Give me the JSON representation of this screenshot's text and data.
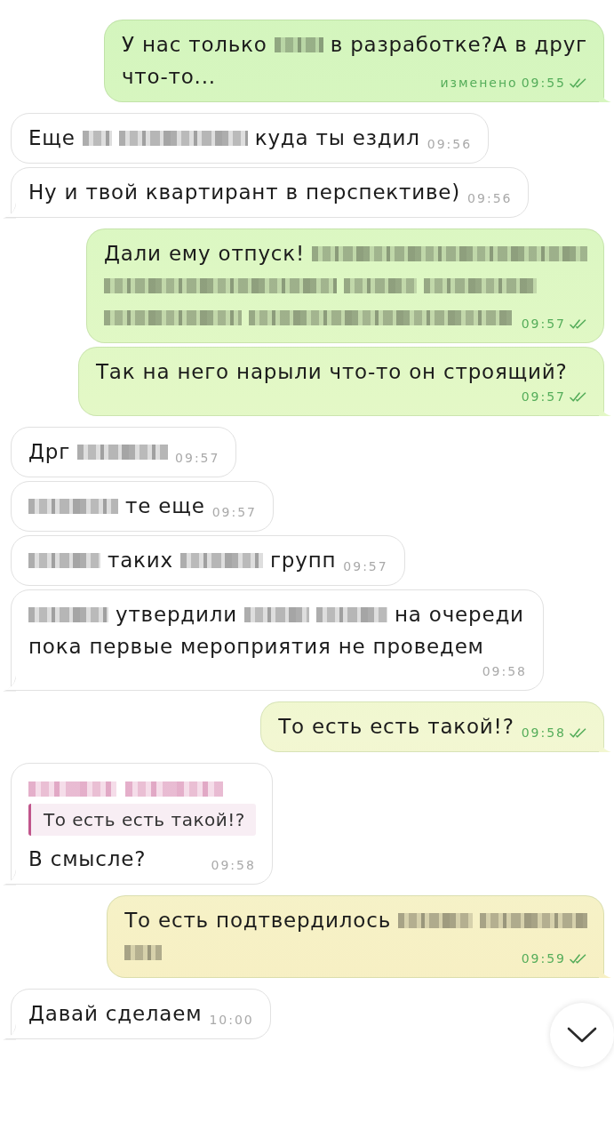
{
  "chat": {
    "messages": [
      {
        "kind": "outgoing",
        "lines": [
          [
            {
              "kind": "text",
              "text": "У нас только"
            },
            {
              "kind": "redacted"
            },
            {
              "kind": "text",
              "text": "в разработке?А в друг"
            }
          ],
          [
            {
              "kind": "text",
              "text": "что-то..."
            }
          ]
        ],
        "edited_label": "изменено",
        "time": "09:55",
        "read": true
      },
      {
        "kind": "incoming",
        "lines": [
          [
            {
              "kind": "text",
              "text": "Еще"
            },
            {
              "kind": "redacted"
            },
            {
              "kind": "redacted"
            },
            {
              "kind": "text",
              "text": "куда ты ездил"
            }
          ]
        ],
        "time": "09:56"
      },
      {
        "kind": "incoming",
        "lines": [
          [
            {
              "kind": "text",
              "text": "Ну и твой квартирант в перспективе)"
            }
          ]
        ],
        "time": "09:56"
      },
      {
        "kind": "outgoing",
        "lines": [
          [
            {
              "kind": "text",
              "text": "Дали ему отпуск!"
            },
            {
              "kind": "redacted"
            }
          ],
          [
            {
              "kind": "redacted"
            },
            {
              "kind": "redacted"
            },
            {
              "kind": "redacted"
            }
          ],
          [
            {
              "kind": "redacted"
            },
            {
              "kind": "redacted"
            }
          ]
        ],
        "time": "09:57",
        "read": true
      },
      {
        "kind": "outgoing",
        "lines": [
          [
            {
              "kind": "text",
              "text": "Так на него нарыли что-то он строящий?"
            }
          ]
        ],
        "time": "09:57",
        "read": true
      },
      {
        "kind": "incoming",
        "lines": [
          [
            {
              "kind": "text",
              "text": "Дрг"
            },
            {
              "kind": "redacted"
            }
          ]
        ],
        "time": "09:57"
      },
      {
        "kind": "incoming",
        "lines": [
          [
            {
              "kind": "redacted"
            },
            {
              "kind": "text",
              "text": "те еще"
            }
          ]
        ],
        "time": "09:57"
      },
      {
        "kind": "incoming",
        "lines": [
          [
            {
              "kind": "redacted"
            },
            {
              "kind": "text",
              "text": "таких"
            },
            {
              "kind": "redacted"
            },
            {
              "kind": "text",
              "text": "групп"
            }
          ]
        ],
        "time": "09:57"
      },
      {
        "kind": "incoming",
        "lines": [
          [
            {
              "kind": "redacted"
            },
            {
              "kind": "text",
              "text": "утвердили"
            },
            {
              "kind": "redacted"
            },
            {
              "kind": "redacted"
            },
            {
              "kind": "text",
              "text": "на очереди"
            }
          ],
          [
            {
              "kind": "text",
              "text": "пока первые мероприятия не проведем"
            }
          ]
        ],
        "time": "09:58"
      },
      {
        "kind": "outgoing",
        "lines": [
          [
            {
              "kind": "text",
              "text": "То есть есть такой!?"
            }
          ]
        ],
        "time": "09:58",
        "read": true
      },
      {
        "kind": "incoming",
        "reply": {
          "author": [
            {
              "kind": "redacted"
            },
            {
              "kind": "redacted"
            }
          ],
          "text": "То есть есть такой!?"
        },
        "lines": [
          [
            {
              "kind": "text",
              "text": "В смысле?"
            }
          ]
        ],
        "time": "09:58"
      },
      {
        "kind": "outgoing",
        "lines": [
          [
            {
              "kind": "text",
              "text": "То есть подтвердилось"
            },
            {
              "kind": "redacted"
            },
            {
              "kind": "redacted"
            }
          ],
          [
            {
              "kind": "redacted"
            }
          ]
        ],
        "time": "09:59",
        "read": true
      },
      {
        "kind": "incoming",
        "lines": [
          [
            {
              "kind": "text",
              "text": "Давай сделаем"
            }
          ]
        ],
        "time": "10:00"
      }
    ]
  },
  "scroll_down_button": {
    "shown": true
  }
}
